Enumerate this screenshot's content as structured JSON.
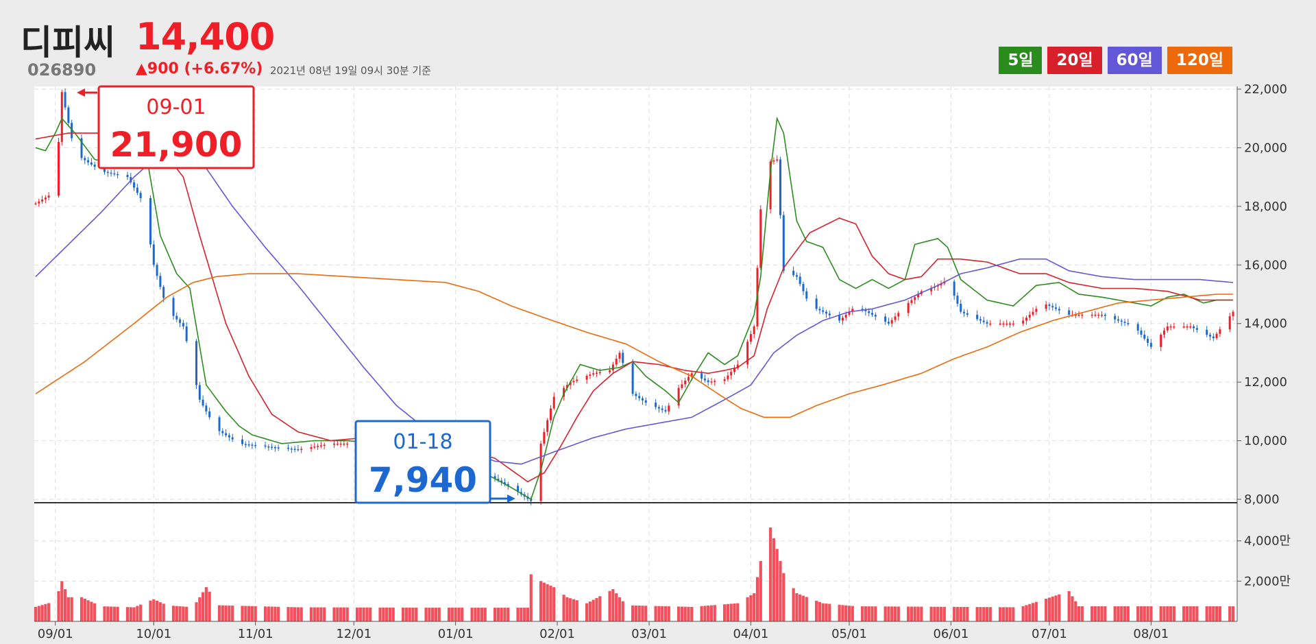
{
  "header": {
    "name": "디피씨",
    "price": "14,400",
    "code": "026890",
    "change": "▲900 (+6.67%)",
    "basis": "2021년 08년 19일 09시 30분 기준"
  },
  "legend": [
    {
      "label": "5일",
      "color": "#2b8c1e"
    },
    {
      "label": "20일",
      "color": "#d8202a"
    },
    {
      "label": "60일",
      "color": "#6257d6"
    },
    {
      "label": "120일",
      "color": "#ec6a0a"
    }
  ],
  "callouts": {
    "high": {
      "date": "09-01",
      "value": "21,900",
      "color": "#f01f27"
    },
    "low": {
      "date": "01-18",
      "value": "7,940",
      "color": "#1c68d0"
    }
  },
  "chart_data": {
    "type": "candlestick",
    "price_axis": {
      "ticks": [
        "22,000",
        "20,000",
        "18,000",
        "16,000",
        "14,000",
        "12,000",
        "10,000",
        "8,000"
      ],
      "range": [
        8000,
        22000
      ]
    },
    "volume_axis": {
      "ticks": [
        "4,000만",
        "2,000만"
      ],
      "range": [
        0,
        60000000
      ]
    },
    "x_axis": {
      "ticks": [
        "09/01",
        "10/01",
        "11/01",
        "12/01",
        "01/01",
        "02/01",
        "03/01",
        "04/01",
        "05/01",
        "06/01",
        "07/01",
        "08/01"
      ],
      "tick_days": [
        6,
        36,
        67,
        97,
        128,
        159,
        187,
        218,
        248,
        279,
        309,
        340
      ]
    },
    "period": [
      "2020-08-20",
      "2021-08-19"
    ],
    "days_span": 365,
    "price_anchors": [
      [
        0,
        18100
      ],
      [
        6,
        18500
      ],
      [
        8,
        21900
      ],
      [
        12,
        19800
      ],
      [
        20,
        19200
      ],
      [
        28,
        19000
      ],
      [
        33,
        18100
      ],
      [
        36,
        16000
      ],
      [
        40,
        14500
      ],
      [
        45,
        13900
      ],
      [
        50,
        11400
      ],
      [
        55,
        10400
      ],
      [
        62,
        9900
      ],
      [
        70,
        9800
      ],
      [
        80,
        9700
      ],
      [
        90,
        9900
      ],
      [
        100,
        9900
      ],
      [
        110,
        9800
      ],
      [
        120,
        9500
      ],
      [
        130,
        9000
      ],
      [
        140,
        8700
      ],
      [
        145,
        8400
      ],
      [
        151,
        7940
      ],
      [
        154,
        9900
      ],
      [
        158,
        11500
      ],
      [
        163,
        12000
      ],
      [
        170,
        12300
      ],
      [
        175,
        12400
      ],
      [
        178,
        13000
      ],
      [
        182,
        11600
      ],
      [
        186,
        11300
      ],
      [
        192,
        11000
      ],
      [
        196,
        11800
      ],
      [
        200,
        12300
      ],
      [
        205,
        12000
      ],
      [
        210,
        12100
      ],
      [
        214,
        12600
      ],
      [
        219,
        13900
      ],
      [
        221,
        17900
      ],
      [
        223,
        19500
      ],
      [
        226,
        19600
      ],
      [
        228,
        15800
      ],
      [
        232,
        15600
      ],
      [
        236,
        14600
      ],
      [
        240,
        14400
      ],
      [
        245,
        14100
      ],
      [
        250,
        14600
      ],
      [
        255,
        14300
      ],
      [
        260,
        14000
      ],
      [
        265,
        14600
      ],
      [
        270,
        15100
      ],
      [
        275,
        15300
      ],
      [
        278,
        15500
      ],
      [
        282,
        14400
      ],
      [
        290,
        14000
      ],
      [
        300,
        14000
      ],
      [
        307,
        14700
      ],
      [
        315,
        14300
      ],
      [
        325,
        14300
      ],
      [
        335,
        13900
      ],
      [
        340,
        13200
      ],
      [
        345,
        13900
      ],
      [
        352,
        13900
      ],
      [
        359,
        13500
      ],
      [
        365,
        14400
      ]
    ],
    "volume_anchors": [
      [
        0,
        7200000
      ],
      [
        6,
        10000000
      ],
      [
        8,
        20000000
      ],
      [
        10,
        12000000
      ],
      [
        14,
        12000000
      ],
      [
        20,
        7500000
      ],
      [
        30,
        7000000
      ],
      [
        36,
        11000000
      ],
      [
        40,
        8000000
      ],
      [
        48,
        7000000
      ],
      [
        52,
        17000000
      ],
      [
        56,
        8000000
      ],
      [
        80,
        7000000
      ],
      [
        120,
        6800000
      ],
      [
        150,
        6800000
      ],
      [
        152,
        40000000
      ],
      [
        154,
        20000000
      ],
      [
        158,
        17000000
      ],
      [
        162,
        12000000
      ],
      [
        168,
        9000000
      ],
      [
        176,
        16000000
      ],
      [
        180,
        8000000
      ],
      [
        200,
        7200000
      ],
      [
        214,
        9000000
      ],
      [
        219,
        14000000
      ],
      [
        221,
        30000000
      ],
      [
        223,
        52000000
      ],
      [
        226,
        36000000
      ],
      [
        228,
        24000000
      ],
      [
        232,
        14000000
      ],
      [
        240,
        9000000
      ],
      [
        250,
        7500000
      ],
      [
        300,
        7000000
      ],
      [
        315,
        15000000
      ],
      [
        318,
        7500000
      ],
      [
        365,
        7500000
      ]
    ],
    "series": [
      {
        "name": "5일",
        "color": "#2b8c1e",
        "points": [
          [
            0,
            20000
          ],
          [
            3,
            19900
          ],
          [
            6,
            20500
          ],
          [
            8,
            21000
          ],
          [
            12,
            20500
          ],
          [
            18,
            19600
          ],
          [
            26,
            19400
          ],
          [
            32,
            19500
          ],
          [
            34,
            19600
          ],
          [
            38,
            17000
          ],
          [
            43,
            15700
          ],
          [
            47,
            15200
          ],
          [
            52,
            11900
          ],
          [
            58,
            11000
          ],
          [
            62,
            10500
          ],
          [
            66,
            10200
          ],
          [
            75,
            9900
          ],
          [
            85,
            10000
          ],
          [
            95,
            10000
          ],
          [
            105,
            9900
          ],
          [
            115,
            9800
          ],
          [
            125,
            9500
          ],
          [
            135,
            9000
          ],
          [
            145,
            8400
          ],
          [
            151,
            8000
          ],
          [
            154,
            9000
          ],
          [
            158,
            10800
          ],
          [
            161,
            11600
          ],
          [
            166,
            12600
          ],
          [
            172,
            12400
          ],
          [
            178,
            12500
          ],
          [
            182,
            12700
          ],
          [
            186,
            12200
          ],
          [
            192,
            11700
          ],
          [
            196,
            11300
          ],
          [
            200,
            12100
          ],
          [
            205,
            13000
          ],
          [
            210,
            12600
          ],
          [
            214,
            12900
          ],
          [
            219,
            14300
          ],
          [
            221,
            15600
          ],
          [
            224,
            19200
          ],
          [
            226,
            21000
          ],
          [
            228,
            20500
          ],
          [
            232,
            17500
          ],
          [
            235,
            16800
          ],
          [
            240,
            16600
          ],
          [
            245,
            15500
          ],
          [
            250,
            15200
          ],
          [
            255,
            15500
          ],
          [
            260,
            15200
          ],
          [
            265,
            15500
          ],
          [
            268,
            16700
          ],
          [
            275,
            16900
          ],
          [
            278,
            16600
          ],
          [
            282,
            15500
          ],
          [
            290,
            14800
          ],
          [
            298,
            14600
          ],
          [
            305,
            15300
          ],
          [
            312,
            15400
          ],
          [
            318,
            15000
          ],
          [
            325,
            14900
          ],
          [
            335,
            14700
          ],
          [
            340,
            14600
          ],
          [
            345,
            14900
          ],
          [
            350,
            15000
          ],
          [
            356,
            14700
          ],
          [
            360,
            14800
          ],
          [
            365,
            14800
          ]
        ]
      },
      {
        "name": "20일",
        "color": "#d8202a",
        "points": [
          [
            0,
            20300
          ],
          [
            10,
            20500
          ],
          [
            20,
            20500
          ],
          [
            30,
            20400
          ],
          [
            38,
            20000
          ],
          [
            45,
            19000
          ],
          [
            50,
            17000
          ],
          [
            58,
            14000
          ],
          [
            65,
            12200
          ],
          [
            72,
            10900
          ],
          [
            80,
            10300
          ],
          [
            90,
            10000
          ],
          [
            100,
            10100
          ],
          [
            110,
            10000
          ],
          [
            120,
            9800
          ],
          [
            130,
            9700
          ],
          [
            140,
            9400
          ],
          [
            150,
            8600
          ],
          [
            155,
            8900
          ],
          [
            160,
            9800
          ],
          [
            165,
            10800
          ],
          [
            170,
            11700
          ],
          [
            176,
            12300
          ],
          [
            182,
            12700
          ],
          [
            190,
            12600
          ],
          [
            198,
            12400
          ],
          [
            205,
            12300
          ],
          [
            210,
            12400
          ],
          [
            214,
            12500
          ],
          [
            219,
            12900
          ],
          [
            223,
            14500
          ],
          [
            228,
            15900
          ],
          [
            236,
            17100
          ],
          [
            245,
            17600
          ],
          [
            250,
            17400
          ],
          [
            255,
            16300
          ],
          [
            260,
            15700
          ],
          [
            265,
            15500
          ],
          [
            270,
            15600
          ],
          [
            275,
            16200
          ],
          [
            282,
            16200
          ],
          [
            290,
            16100
          ],
          [
            300,
            15700
          ],
          [
            308,
            15700
          ],
          [
            315,
            15400
          ],
          [
            325,
            15200
          ],
          [
            335,
            15200
          ],
          [
            345,
            15100
          ],
          [
            355,
            14800
          ],
          [
            365,
            14800
          ]
        ]
      },
      {
        "name": "60일",
        "color": "#6257d6",
        "points": [
          [
            0,
            15600
          ],
          [
            10,
            16700
          ],
          [
            20,
            17800
          ],
          [
            30,
            19000
          ],
          [
            38,
            19800
          ],
          [
            46,
            19700
          ],
          [
            52,
            19300
          ],
          [
            60,
            18000
          ],
          [
            70,
            16600
          ],
          [
            80,
            15300
          ],
          [
            90,
            13900
          ],
          [
            100,
            12500
          ],
          [
            110,
            11200
          ],
          [
            120,
            10300
          ],
          [
            130,
            9700
          ],
          [
            140,
            9300
          ],
          [
            148,
            9200
          ],
          [
            160,
            9700
          ],
          [
            170,
            10100
          ],
          [
            180,
            10400
          ],
          [
            190,
            10600
          ],
          [
            200,
            10800
          ],
          [
            210,
            11400
          ],
          [
            218,
            11900
          ],
          [
            225,
            13000
          ],
          [
            232,
            13600
          ],
          [
            240,
            14100
          ],
          [
            248,
            14400
          ],
          [
            255,
            14500
          ],
          [
            265,
            14800
          ],
          [
            275,
            15300
          ],
          [
            282,
            15700
          ],
          [
            290,
            15900
          ],
          [
            300,
            16200
          ],
          [
            308,
            16200
          ],
          [
            315,
            15800
          ],
          [
            325,
            15600
          ],
          [
            335,
            15500
          ],
          [
            345,
            15500
          ],
          [
            355,
            15500
          ],
          [
            365,
            15400
          ]
        ]
      },
      {
        "name": "120일",
        "color": "#ec6a0a",
        "points": [
          [
            0,
            11600
          ],
          [
            15,
            12700
          ],
          [
            30,
            14000
          ],
          [
            40,
            14900
          ],
          [
            48,
            15400
          ],
          [
            55,
            15600
          ],
          [
            65,
            15700
          ],
          [
            80,
            15700
          ],
          [
            95,
            15600
          ],
          [
            110,
            15500
          ],
          [
            125,
            15400
          ],
          [
            135,
            15100
          ],
          [
            145,
            14600
          ],
          [
            155,
            14200
          ],
          [
            168,
            13700
          ],
          [
            180,
            13300
          ],
          [
            190,
            12700
          ],
          [
            200,
            12200
          ],
          [
            208,
            11600
          ],
          [
            215,
            11100
          ],
          [
            222,
            10800
          ],
          [
            230,
            10800
          ],
          [
            238,
            11200
          ],
          [
            248,
            11600
          ],
          [
            258,
            11900
          ],
          [
            270,
            12300
          ],
          [
            280,
            12800
          ],
          [
            290,
            13200
          ],
          [
            300,
            13700
          ],
          [
            310,
            14100
          ],
          [
            320,
            14400
          ],
          [
            330,
            14700
          ],
          [
            340,
            14800
          ],
          [
            350,
            14900
          ],
          [
            360,
            15000
          ],
          [
            365,
            15000
          ]
        ]
      }
    ]
  }
}
